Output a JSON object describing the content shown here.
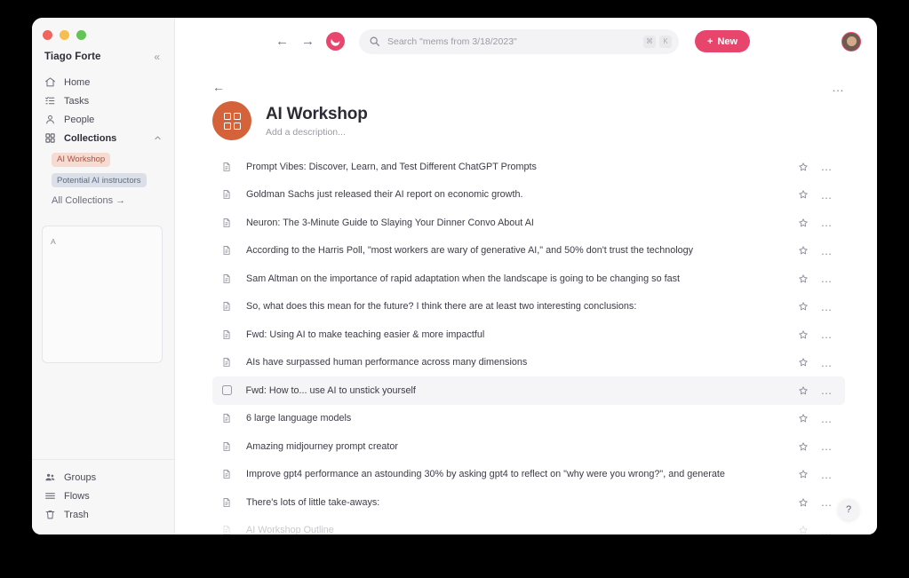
{
  "window": {
    "traffic_lights": [
      "close",
      "minimize",
      "maximize"
    ]
  },
  "sidebar": {
    "account_name": "Tiago Forte",
    "collapse_icon": "«",
    "nav_items": [
      {
        "label": "Home",
        "icon": "home-icon"
      },
      {
        "label": "Tasks",
        "icon": "tasks-icon"
      },
      {
        "label": "People",
        "icon": "people-icon"
      },
      {
        "label": "Collections",
        "icon": "collections-icon",
        "chevron": "⌃"
      }
    ],
    "collection_tags": [
      {
        "label": "AI Workshop",
        "color": "#b0503a",
        "background": "#f6dbd2"
      },
      {
        "label": "Potential AI instructors",
        "color": "#5b6b86",
        "background": "#dbe0e8"
      }
    ],
    "all_collections_label": "All Collections →",
    "panel_card_text": "A",
    "bottom_items": [
      {
        "label": "Groups",
        "icon": "groups-icon"
      },
      {
        "label": "Flows",
        "icon": "flows-icon"
      },
      {
        "label": "Trash",
        "icon": "trash-icon"
      }
    ]
  },
  "topbar": {
    "back_arrow": "←",
    "forward_arrow": "→",
    "brand": "mem-logo",
    "search_placeholder": "Search \"mems from 3/18/2023\"",
    "shortcut_keys": [
      "⌘",
      "K"
    ],
    "new_button_label": "New",
    "new_button_plus": "+",
    "new_button_color": "#e8456c",
    "avatar": "user-avatar"
  },
  "page": {
    "back_arrow": "←",
    "more_label": "…",
    "collection_icon_color": "#d4633c",
    "title": "AI Workshop",
    "description_placeholder": "Add a description..."
  },
  "list": {
    "items": [
      {
        "title": "Prompt Vibes: Discover, Learn, and Test Different ChatGPT Prompts",
        "state": "normal"
      },
      {
        "title": "Goldman Sachs just released their AI report on economic growth.",
        "state": "normal"
      },
      {
        "title": "Neuron: The 3-Minute Guide to Slaying Your Dinner Convo About AI",
        "state": "normal"
      },
      {
        "title": "According to the Harris Poll, \"most workers are wary of generative AI,\" and 50% don't trust the technology",
        "state": "normal"
      },
      {
        "title": "Sam Altman on the importance of rapid adaptation when the landscape is going to be changing so fast",
        "state": "normal"
      },
      {
        "title": "So, what does this mean for the future? I think there are at least two interesting conclusions:",
        "state": "normal"
      },
      {
        "title": "Fwd: Using AI to make teaching easier & more impactful",
        "state": "normal"
      },
      {
        "title": "AIs have surpassed human performance across many dimensions",
        "state": "normal"
      },
      {
        "title": "Fwd: How to... use AI to unstick yourself",
        "state": "hovered"
      },
      {
        "title": "6 large language models",
        "state": "normal"
      },
      {
        "title": "Amazing midjourney prompt creator",
        "state": "normal"
      },
      {
        "title": "Improve gpt4 performance an astounding 30% by asking gpt4 to reflect on \"why were you wrong?\", and generate",
        "state": "normal"
      },
      {
        "title": "There's lots of little take-aways:",
        "state": "normal"
      },
      {
        "title": "AI Workshop Outline",
        "state": "cut-off"
      }
    ],
    "row_star_icon": "star-icon",
    "row_more_icon": "…"
  },
  "help": {
    "label": "?"
  }
}
